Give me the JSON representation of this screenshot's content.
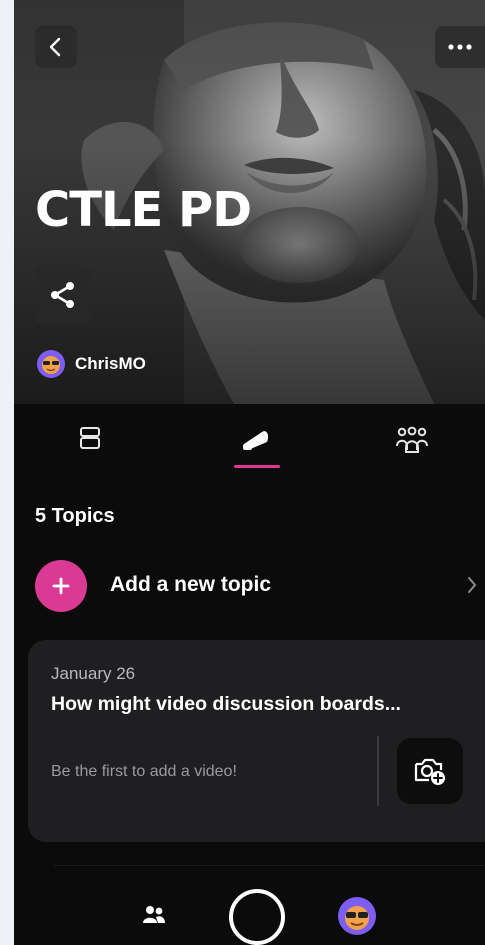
{
  "header": {
    "title": "CTLE PD",
    "owner_name": "ChrisMO"
  },
  "icons": {
    "back": "chevron-left-icon",
    "more": "ellipsis-icon",
    "share": "share-icon",
    "tab_posts": "layout-icon",
    "tab_topics": "megaphone-icon",
    "tab_members": "group-icon",
    "add": "plus-icon",
    "chevron": "chevron-right-icon",
    "add_video": "camera-plus-icon",
    "nav_people": "people-icon",
    "nav_record": "record-icon",
    "nav_profile": "avatar-icon"
  },
  "tabs": {
    "active": "topics"
  },
  "topics": {
    "count_label": "5 Topics",
    "add_label": "Add a new topic",
    "items": [
      {
        "date": "January 26",
        "title": "How might video discussion boards...",
        "empty_text": "Be the first to add a video!"
      }
    ]
  },
  "colors": {
    "accent": "#da3a93",
    "tab_underline": "#e0368f",
    "background": "#0b0b0c",
    "card": "#1f1f21",
    "avatar": "#7e5ef2"
  }
}
